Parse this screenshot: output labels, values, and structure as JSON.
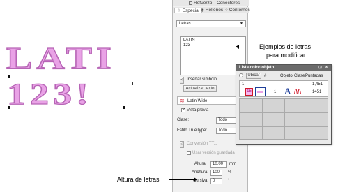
{
  "colors": {
    "thread_fill": "#e9a2e6",
    "thread_edge": "#b765b6",
    "panel": "#f1f1f1",
    "popup_title": "#6b6b6b",
    "accent_red": "#d0192a",
    "accent_blue": "#1f3f9a"
  },
  "canvas": {
    "line1": "LATI",
    "line2": "123!"
  },
  "panel": {
    "tabs_top": [
      "Refuerzo",
      "Conectores"
    ],
    "tabs_bottom": [
      "Especial",
      "Rellenos",
      "Contornos"
    ],
    "mode_dropdown": "Letras",
    "text_value": "LATIN\n123",
    "insert_symbol": "Insertar símbolo...",
    "update_text": "Actualizar texto",
    "font_name": "Latin Wide",
    "preview_label": "Vista previa",
    "class_label": "Clase:",
    "class_value": "Todo",
    "truetype_label": "Estilo TrueType:",
    "truetype_value": "Todo",
    "convert_button": "Conversión TT...",
    "saved_version": "Usar versión guardada",
    "height_label": "Altura:",
    "height_value": "10.00",
    "height_unit": "mm",
    "width_label": "Anchura:",
    "width_value": "100",
    "width_unit": "%",
    "italic_label": "Cursiva:",
    "italic_value": "0",
    "italic_unit": "°"
  },
  "popup": {
    "title": "Lista color-objeto",
    "sort_button": "Ubicar",
    "col_hash": "#",
    "col_obj": "Objeto",
    "col_class": "Clase",
    "col_stitches": "Puntadas",
    "row1": {
      "num": "1",
      "stitches": "1,451"
    },
    "row2": {
      "swatch_num": "15",
      "num": "1",
      "glyph": "A",
      "stitches": "1451"
    }
  },
  "annotations": {
    "examples_line1": "Ejemplos de letras",
    "examples_line2": "para modificar",
    "height_note": "Altura de letras"
  }
}
